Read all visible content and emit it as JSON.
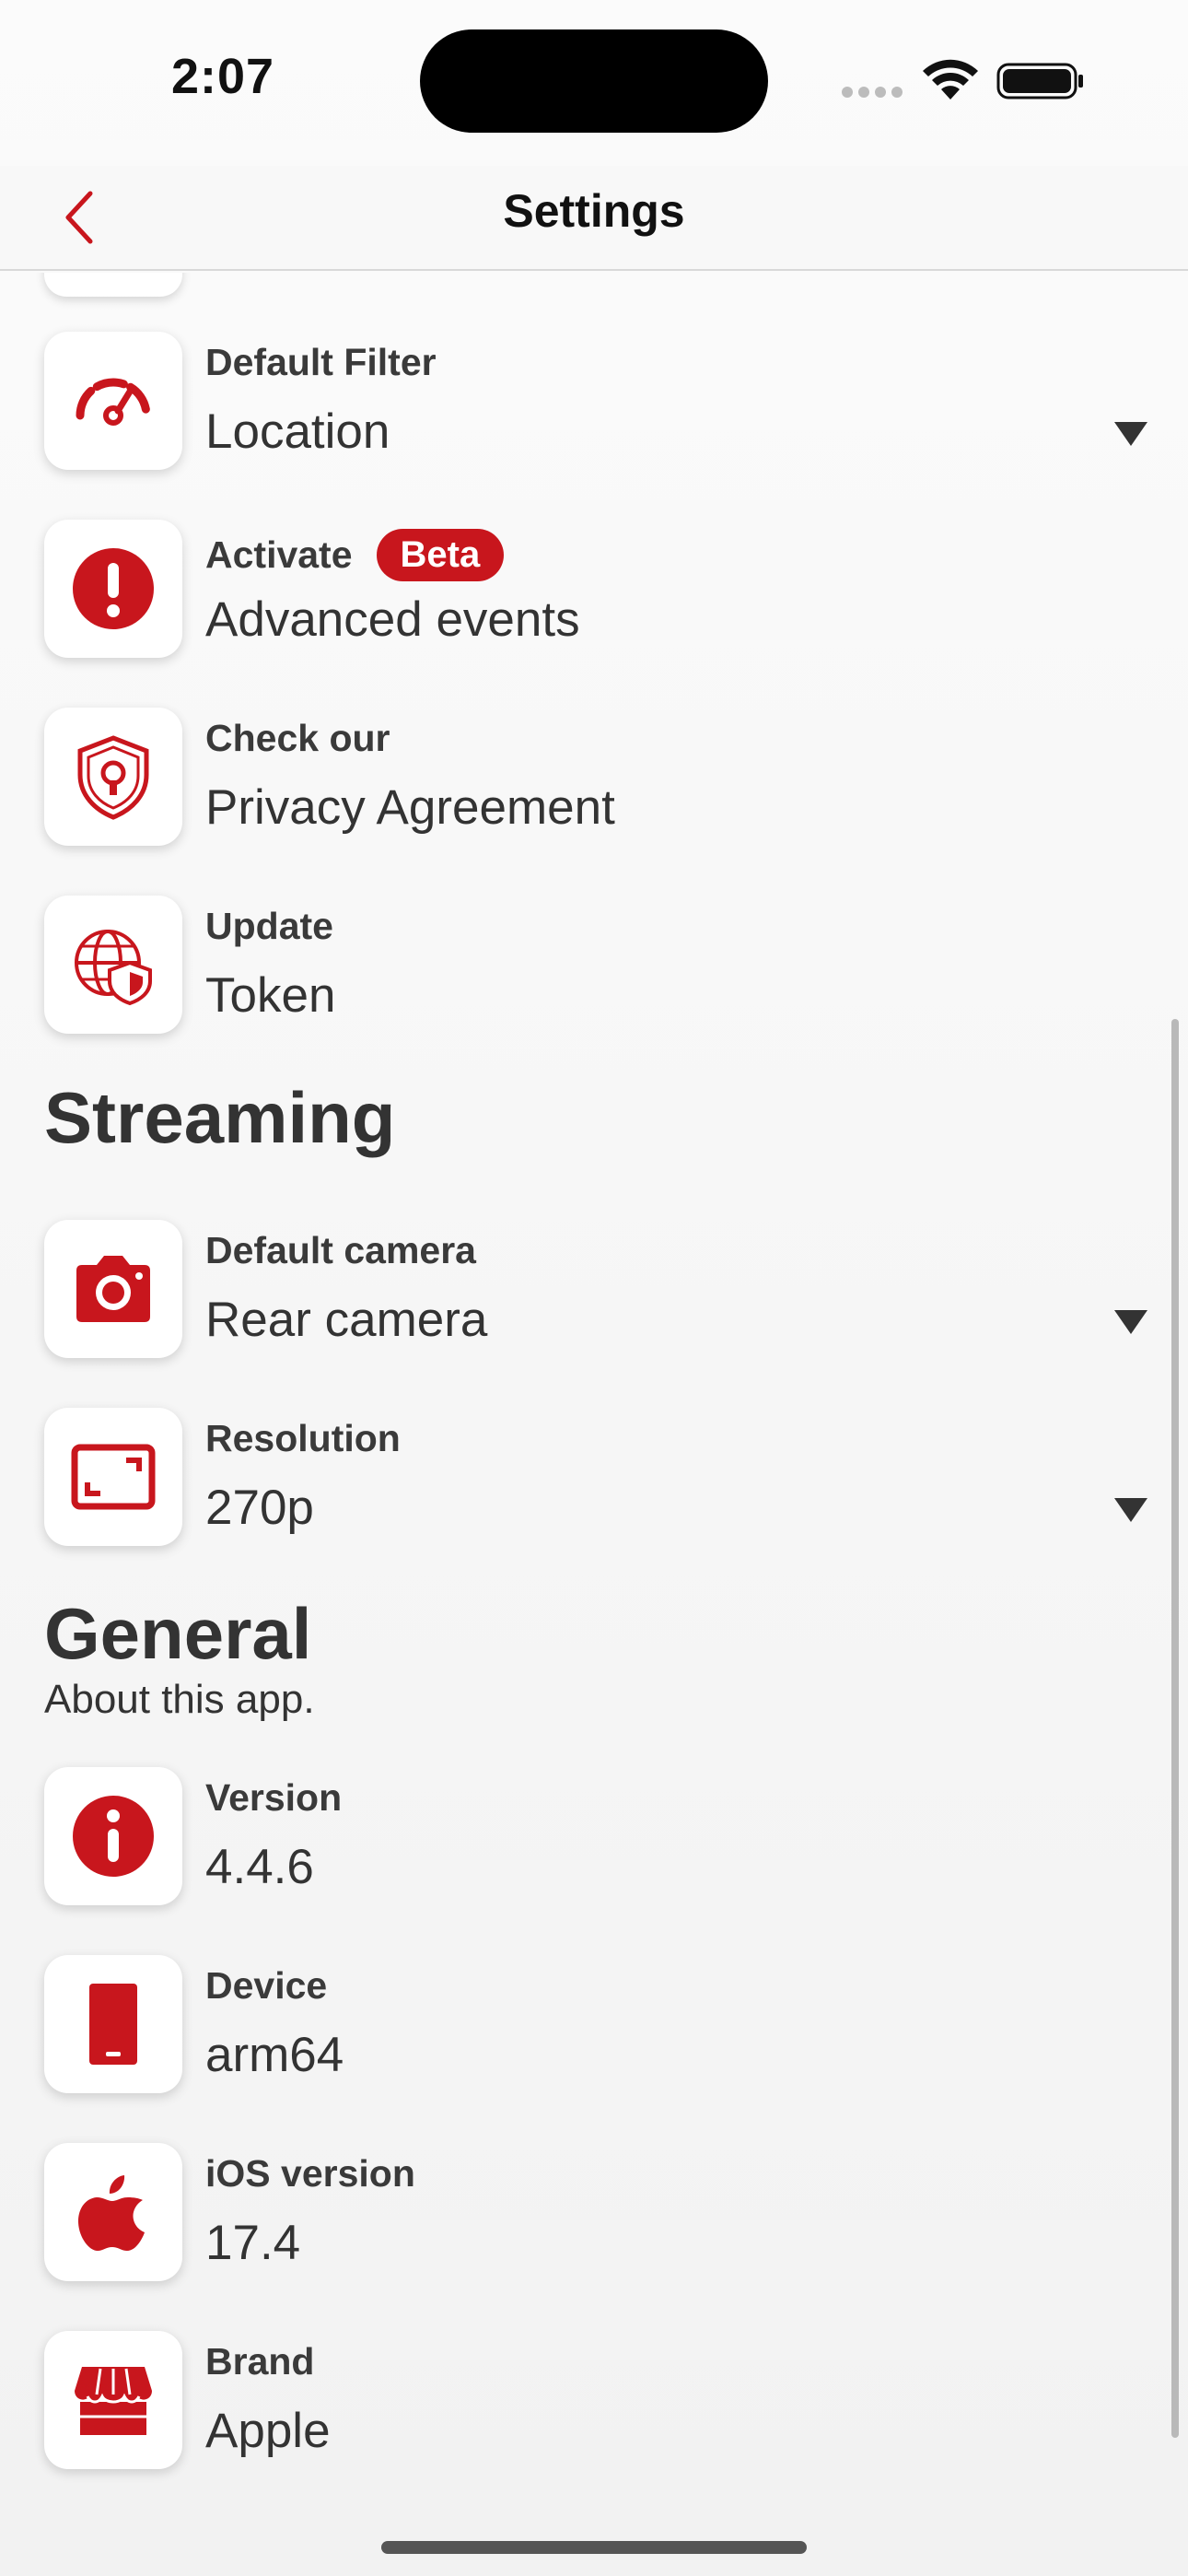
{
  "status_bar": {
    "time": "2:07"
  },
  "nav": {
    "title": "Settings"
  },
  "colors": {
    "accent": "#c8161d",
    "text": "#333333"
  },
  "rows_top": [
    {
      "label": "Default Filter",
      "value": "Location",
      "icon": "speedometer-icon",
      "dropdown": true
    },
    {
      "label": "Activate",
      "badge": "Beta",
      "value": "Advanced events",
      "icon": "exclamation-icon",
      "dropdown": false
    },
    {
      "label": "Check our",
      "value": "Privacy Agreement",
      "icon": "shield-lock-icon",
      "dropdown": false
    },
    {
      "label": "Update",
      "value": "Token",
      "icon": "globe-shield-icon",
      "dropdown": false
    }
  ],
  "streaming": {
    "title": "Streaming",
    "rows": [
      {
        "label": "Default camera",
        "value": "Rear camera",
        "icon": "camera-icon",
        "dropdown": true
      },
      {
        "label": "Resolution",
        "value": "270p",
        "icon": "resolution-icon",
        "dropdown": true
      }
    ]
  },
  "general": {
    "title": "General",
    "subtitle": "About this app.",
    "rows": [
      {
        "label": "Version",
        "value": "4.4.6",
        "icon": "info-icon"
      },
      {
        "label": "Device",
        "value": "arm64",
        "icon": "phone-icon"
      },
      {
        "label": "iOS version",
        "value": "17.4",
        "icon": "apple-icon"
      },
      {
        "label": "Brand",
        "value": "Apple",
        "icon": "store-icon"
      }
    ]
  }
}
